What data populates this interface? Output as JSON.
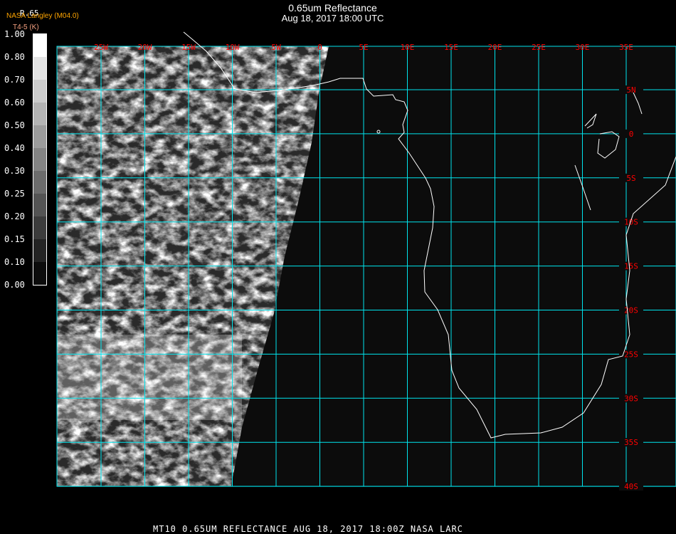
{
  "header": {
    "title": "0.65um Reflectance",
    "subtitle": "Aug 18, 2017 18:00 UTC",
    "credit": "NASA Langley (M04.0)",
    "parameter": "R.65",
    "units": "T4-5 (K)"
  },
  "legend": {
    "labels": [
      "1.00",
      "0.80",
      "0.70",
      "0.60",
      "0.50",
      "0.40",
      "0.30",
      "0.25",
      "0.20",
      "0.15",
      "0.10",
      "0.00"
    ],
    "colors": [
      "#ffffff",
      "#e4e4e4",
      "#cccccc",
      "#b4b4b4",
      "#9c9c9c",
      "#848484",
      "#6c6c6c",
      "#545454",
      "#3c3c3c",
      "#242424",
      "#0c0c0c"
    ]
  },
  "map": {
    "lon_labels": [
      "25W",
      "20W",
      "15W",
      "10W",
      "5W",
      "0",
      "5E",
      "10E",
      "15E",
      "20E",
      "25E",
      "30E",
      "35E"
    ],
    "lat_labels": [
      "5N",
      "0",
      "5S",
      "10S",
      "15S",
      "20S",
      "25S",
      "30S",
      "35S",
      "40S"
    ],
    "grid_color": "#00e5ee",
    "label_color": "#ff0000",
    "coast_color": "#ffffff",
    "background": "#0c0c0c"
  },
  "footer": "MT10  0.65UM REFLECTANCE   AUG 18, 2017 18:00Z   NASA LARC"
}
